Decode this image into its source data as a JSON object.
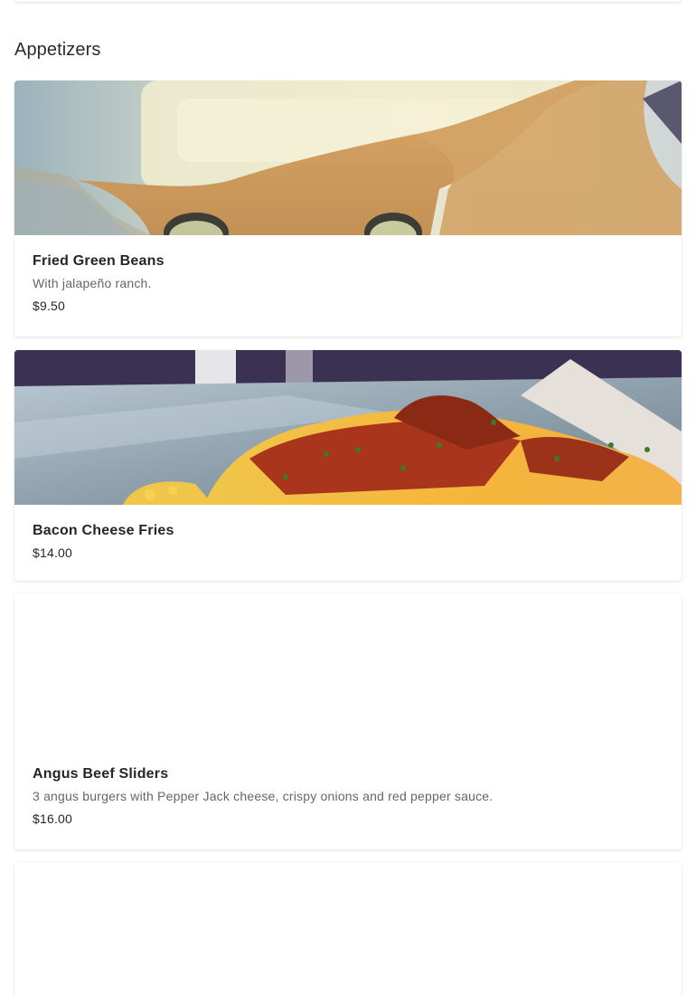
{
  "section": {
    "title": "Appetizers"
  },
  "items": [
    {
      "name": "Fried Green Beans",
      "description": "With jalapeño ranch.",
      "price": "$9.50",
      "image": "fried-green-beans-photo"
    },
    {
      "name": "Bacon Cheese Fries",
      "price": "$14.00",
      "image": "bacon-cheese-fries-photo"
    },
    {
      "name": "Angus Beef Sliders",
      "description": "3 angus burgers with Pepper Jack cheese, crispy onions and red pepper sauce.",
      "price": "$16.00"
    }
  ]
}
